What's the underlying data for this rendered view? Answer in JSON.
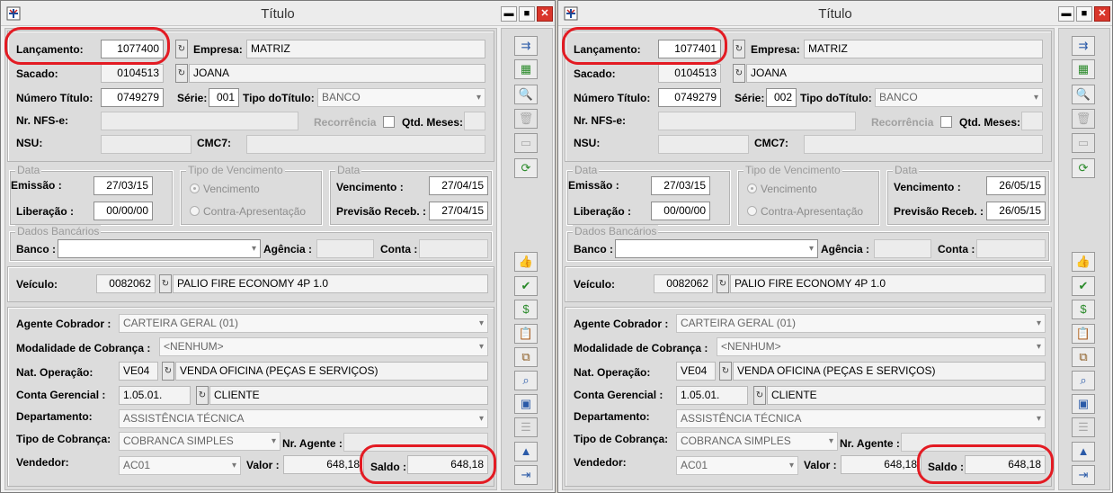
{
  "windows": [
    {
      "title": "Título",
      "lancamento": {
        "label": "Lançamento:",
        "value": "1077400"
      },
      "empresa": {
        "label": "Empresa:",
        "value": "MATRIZ"
      },
      "sacado": {
        "label": "Sacado:",
        "code": "0104513",
        "name": "JOANA"
      },
      "numero_titulo": {
        "label": "Número Título:",
        "value": "0749279"
      },
      "serie": {
        "label": "Série:",
        "value": "001"
      },
      "tipo_titulo": {
        "label": "Tipo doTítulo:",
        "value": "BANCO"
      },
      "nfse": {
        "label": "Nr. NFS-e:",
        "value": ""
      },
      "recorrencia": {
        "label": "Recorrência"
      },
      "qtd_meses": {
        "label": "Qtd. Meses:",
        "value": ""
      },
      "nsu": {
        "label": "NSU:",
        "value": ""
      },
      "cmc7": {
        "label": "CMC7:",
        "value": ""
      },
      "data_group": {
        "title": "Data",
        "emissao_label": "Emissão :",
        "emissao": "27/03/15",
        "liberacao_label": "Liberação :",
        "liberacao": "00/00/00"
      },
      "tipo_venc": {
        "title": "Tipo de Vencimento",
        "opt1": "Vencimento",
        "opt2": "Contra-Apresentação"
      },
      "data2_group": {
        "title": "Data",
        "venc_label": "Vencimento :",
        "venc": "27/04/15",
        "prev_label": "Previsão Receb. :",
        "prev": "27/04/15"
      },
      "bancarios": {
        "title": "Dados Bancários",
        "banco_label": "Banco :",
        "banco": "",
        "agencia_label": "Agência :",
        "agencia": "",
        "conta_label": "Conta :",
        "conta": ""
      },
      "veiculo": {
        "label": "Veículo:",
        "code": "0082062",
        "name": "PALIO FIRE ECONOMY 4P 1.0"
      },
      "agente": {
        "label": "Agente Cobrador :",
        "value": "CARTEIRA GERAL (01)"
      },
      "modalidade": {
        "label": "Modalidade de Cobrança :",
        "value": "<NENHUM>"
      },
      "natop": {
        "label": "Nat. Operação:",
        "code": "VE04",
        "name": "VENDA OFICINA (PEÇAS E SERVIÇOS)"
      },
      "conta_ger": {
        "label": "Conta Gerencial :",
        "code": "1.05.01.",
        "name": "CLIENTE"
      },
      "departamento": {
        "label": "Departamento:",
        "value": "ASSISTÊNCIA TÉCNICA"
      },
      "tipo_cobranca": {
        "label": "Tipo de Cobrança:",
        "value": "COBRANCA SIMPLES"
      },
      "nr_agente": {
        "label": "Nr. Agente :",
        "value": ""
      },
      "vendedor": {
        "label": "Vendedor:",
        "value": "AC01"
      },
      "valor": {
        "label": "Valor :",
        "value": "648,18"
      },
      "saldo": {
        "label": "Saldo :",
        "value": "648,18"
      }
    },
    {
      "title": "Título",
      "lancamento": {
        "label": "Lançamento:",
        "value": "1077401"
      },
      "empresa": {
        "label": "Empresa:",
        "value": "MATRIZ"
      },
      "sacado": {
        "label": "Sacado:",
        "code": "0104513",
        "name": "JOANA"
      },
      "numero_titulo": {
        "label": "Número Título:",
        "value": "0749279"
      },
      "serie": {
        "label": "Série:",
        "value": "002"
      },
      "tipo_titulo": {
        "label": "Tipo doTítulo:",
        "value": "BANCO"
      },
      "nfse": {
        "label": "Nr. NFS-e:",
        "value": ""
      },
      "recorrencia": {
        "label": "Recorrência"
      },
      "qtd_meses": {
        "label": "Qtd. Meses:",
        "value": ""
      },
      "nsu": {
        "label": "NSU:",
        "value": ""
      },
      "cmc7": {
        "label": "CMC7:",
        "value": ""
      },
      "data_group": {
        "title": "Data",
        "emissao_label": "Emissão :",
        "emissao": "27/03/15",
        "liberacao_label": "Liberação :",
        "liberacao": "00/00/00"
      },
      "tipo_venc": {
        "title": "Tipo de Vencimento",
        "opt1": "Vencimento",
        "opt2": "Contra-Apresentação"
      },
      "data2_group": {
        "title": "Data",
        "venc_label": "Vencimento :",
        "venc": "26/05/15",
        "prev_label": "Previsão Receb. :",
        "prev": "26/05/15"
      },
      "bancarios": {
        "title": "Dados Bancários",
        "banco_label": "Banco :",
        "banco": "",
        "agencia_label": "Agência :",
        "agencia": "",
        "conta_label": "Conta :",
        "conta": ""
      },
      "veiculo": {
        "label": "Veículo:",
        "code": "0082062",
        "name": "PALIO FIRE ECONOMY 4P 1.0"
      },
      "agente": {
        "label": "Agente Cobrador :",
        "value": "CARTEIRA GERAL (01)"
      },
      "modalidade": {
        "label": "Modalidade de Cobrança :",
        "value": "<NENHUM>"
      },
      "natop": {
        "label": "Nat. Operação:",
        "code": "VE04",
        "name": "VENDA OFICINA (PEÇAS E SERVIÇOS)"
      },
      "conta_ger": {
        "label": "Conta Gerencial :",
        "code": "1.05.01.",
        "name": "CLIENTE"
      },
      "departamento": {
        "label": "Departamento:",
        "value": "ASSISTÊNCIA TÉCNICA"
      },
      "tipo_cobranca": {
        "label": "Tipo de Cobrança:",
        "value": "COBRANCA SIMPLES"
      },
      "nr_agente": {
        "label": "Nr. Agente :",
        "value": ""
      },
      "vendedor": {
        "label": "Vendedor:",
        "value": "AC01"
      },
      "valor": {
        "label": "Valor :",
        "value": "648,18"
      },
      "saldo": {
        "label": "Saldo :",
        "value": "648,18"
      }
    }
  ],
  "window_buttons": {
    "minimize": "▬",
    "maximize": "■",
    "close": "✕"
  },
  "lookup_glyph": "↻",
  "dropdown_glyph": "▾",
  "toolbar_icons": [
    "insert-rows-icon",
    "table-add-icon",
    "preview-icon",
    "delete-icon",
    "open-folder-icon",
    "refresh-icon",
    "thumbs-up-icon",
    "check-icon",
    "money-bag-icon",
    "clipboard-icon",
    "copy-icon",
    "search-doc-icon",
    "calculator-icon",
    "list-icon",
    "chart-icon",
    "exit-icon"
  ],
  "annotation_color": "#e31b23"
}
